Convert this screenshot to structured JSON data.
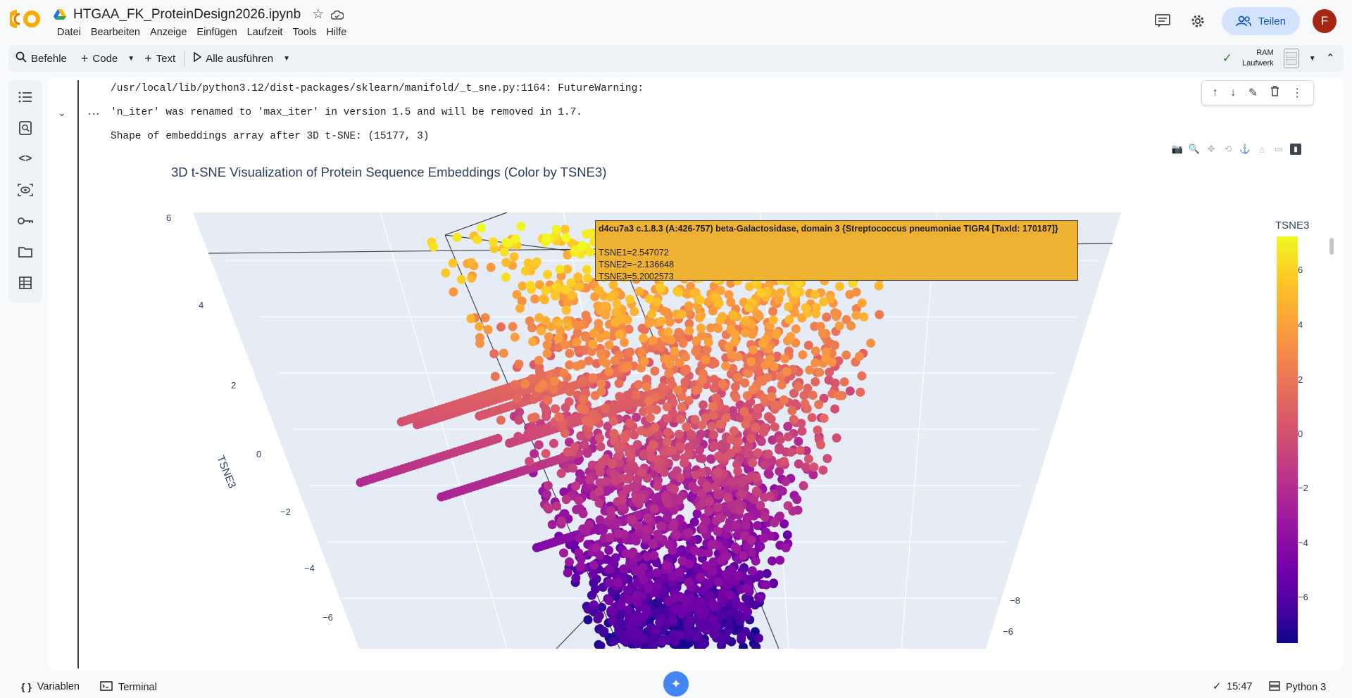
{
  "notebook": {
    "title": "HTGAA_FK_ProteinDesign2026.ipynb"
  },
  "menu": [
    "Datei",
    "Bearbeiten",
    "Anzeige",
    "Einfügen",
    "Laufzeit",
    "Tools",
    "Hilfe"
  ],
  "header": {
    "share_label": "Teilen",
    "avatar_letter": "F"
  },
  "toolbar": {
    "commands_label": "Befehle",
    "code_label": "Code",
    "text_label": "Text",
    "run_all_label": "Alle ausführen",
    "ram_label": "RAM",
    "disk_label": "Laufwerk"
  },
  "output": {
    "line1": "/usr/local/lib/python3.12/dist-packages/sklearn/manifold/_t_sne.py:1164: FutureWarning:",
    "line2": "'n_iter' was renamed to 'max_iter' in version 1.5 and will be removed in 1.7.",
    "line3": "Shape of embeddings array after 3D t-SNE: (15177, 3)"
  },
  "plot": {
    "title": "3D t-SNE Visualization of Protein Sequence Embeddings (Color by TSNE3)",
    "z_axis_label": "TSNE3",
    "z_ticks": [
      "6",
      "4",
      "2",
      "0",
      "−2",
      "−4",
      "−6"
    ],
    "right_axis_ticks": [
      "−8",
      "−6"
    ],
    "colorbar_title": "TSNE3",
    "colorbar_ticks": [
      "6",
      "4",
      "2",
      "0",
      "−2",
      "−4",
      "−6"
    ],
    "colorbar_range": [
      -8,
      7.2
    ]
  },
  "tooltip": {
    "header": "d4cu7a3 c.1.8.3 (A:426-757) beta-Galactosidase, domain 3 {Streptococcus pneumoniae TIGR4 [TaxId: 170187]}",
    "tsne1": "TSNE1=2.547072",
    "tsne2": "TSNE2=−2.136648",
    "tsne3": "TSNE3=5.2002573"
  },
  "statusbar": {
    "variables_label": "Variablen",
    "terminal_label": "Terminal",
    "time": "15:47",
    "runtime": "Python 3"
  },
  "colors": {
    "accent": "#0b57d0",
    "share_bg": "#d3e3fd",
    "plot_bg": "#e5ecf6",
    "avatar": "#a52714"
  }
}
